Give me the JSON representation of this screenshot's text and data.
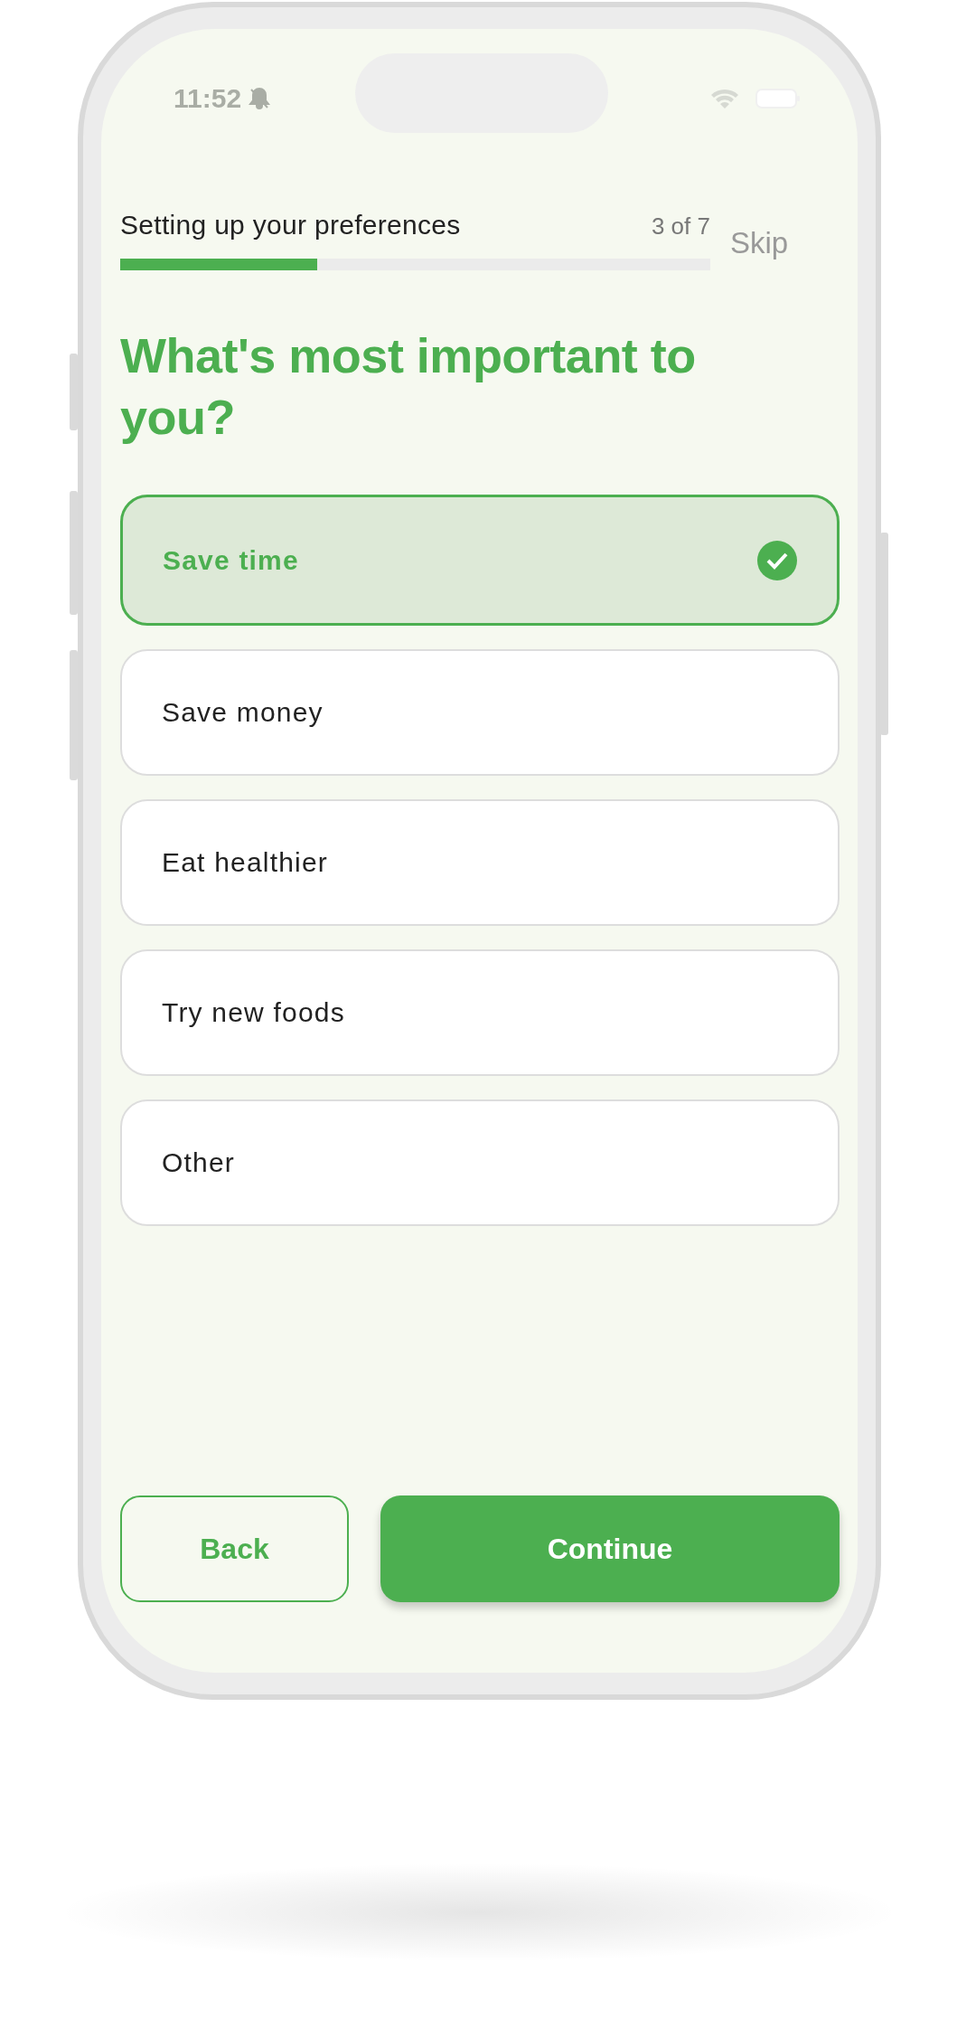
{
  "status_bar": {
    "time": "11:52"
  },
  "header": {
    "title": "Setting up your preferences",
    "step": "3 of 7",
    "level": 0.334,
    "skip": "Skip"
  },
  "question": "What's most important to you?",
  "options": [
    {
      "label": "Save time",
      "selected": true
    },
    {
      "label": "Save money",
      "selected": false
    },
    {
      "label": "Eat healthier",
      "selected": false
    },
    {
      "label": "Try new foods",
      "selected": false
    },
    {
      "label": "Other",
      "selected": false
    }
  ],
  "buttons": {
    "back": "Back",
    "continue": "Continue"
  }
}
